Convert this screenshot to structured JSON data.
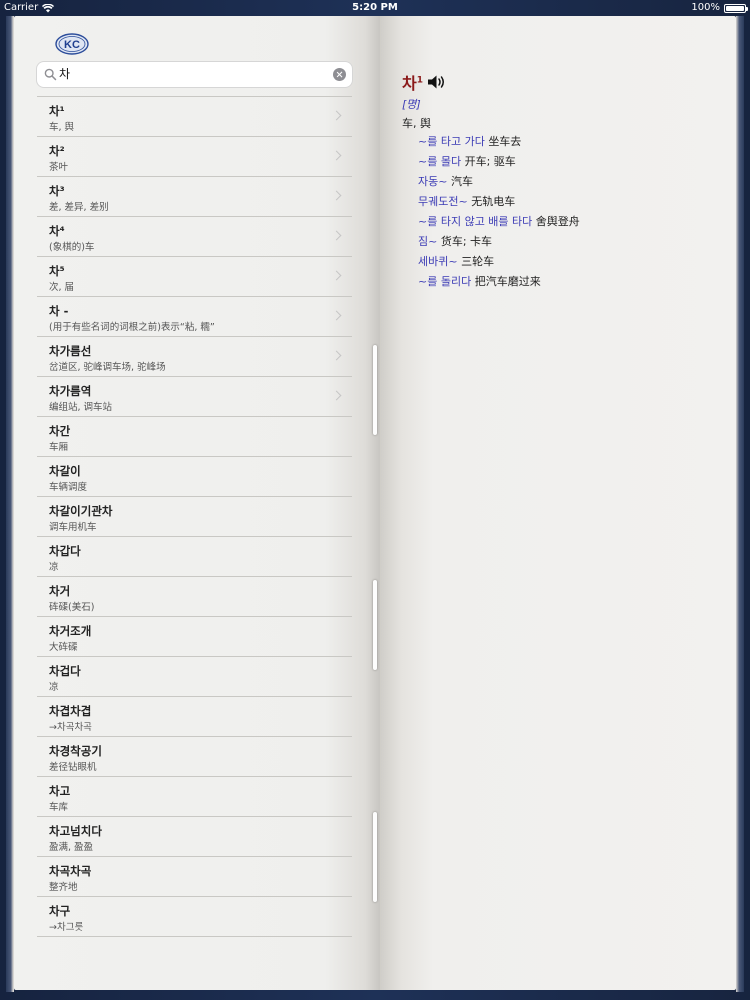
{
  "status_bar": {
    "carrier": "Carrier",
    "time": "5:20 PM",
    "battery": "100%",
    "battery_level": 1.0
  },
  "app": {
    "logo_text": "KC"
  },
  "search": {
    "value": "차",
    "icon": "search-icon",
    "clear_icon": "clear-icon"
  },
  "results": [
    {
      "word": "차¹",
      "sub": "车, 舆"
    },
    {
      "word": "차²",
      "sub": "茶叶"
    },
    {
      "word": "차³",
      "sub": "差, 差异, 差别"
    },
    {
      "word": "차⁴",
      "sub": "(象棋的)车"
    },
    {
      "word": "차⁵",
      "sub": "次, 届"
    },
    {
      "word": "차 -",
      "sub": "(用于有些名词的词根之前)表示“粘, 糯”"
    },
    {
      "word": "차가름선",
      "sub": "岔道区, 驼峰调车场, 驼峰场"
    },
    {
      "word": "차가름역",
      "sub": "编组站, 调车站"
    },
    {
      "word": "차간",
      "sub": "车厢"
    },
    {
      "word": "차갈이",
      "sub": "车辆调度"
    },
    {
      "word": "차갈이기관차",
      "sub": "调车用机车"
    },
    {
      "word": "차갑다",
      "sub": "凉"
    },
    {
      "word": "차거",
      "sub": "砗磲(美石)"
    },
    {
      "word": "차거조개",
      "sub": "大砗磲"
    },
    {
      "word": "차겁다",
      "sub": "凉"
    },
    {
      "word": "차겹차겹",
      "sub": "→차곡차곡"
    },
    {
      "word": "차경착공기",
      "sub": "差径钻眼机"
    },
    {
      "word": "차고",
      "sub": "车库"
    },
    {
      "word": "차고넘치다",
      "sub": "盈满, 盈盈"
    },
    {
      "word": "차곡차곡",
      "sub": "整齐地"
    },
    {
      "word": "차구",
      "sub": "→차그릇"
    }
  ],
  "entry": {
    "headword": "차",
    "superscript": "1",
    "speaker_icon": "speaker-icon",
    "pos": "[명]",
    "meaning": "车, 舆",
    "headword_color": "#8b1a1a",
    "link_color": "#3b3bb5",
    "examples": [
      {
        "ko": "~를 타고 가다",
        "zh": "坐车去"
      },
      {
        "ko": "~를 몰다",
        "zh": "开车; 驱车"
      },
      {
        "ko": "자동~",
        "zh": "汽车"
      },
      {
        "ko": "무궤도전~",
        "zh": "无轨电车"
      },
      {
        "ko": "~를 타지 않고 배를 타다",
        "zh": "舍舆登舟"
      },
      {
        "ko": "짐~",
        "zh": "货车; 卡车"
      },
      {
        "ko": "세바퀴~",
        "zh": "三轮车"
      },
      {
        "ko": "~를 돌리다",
        "zh": "把汽车磨过来"
      }
    ]
  }
}
